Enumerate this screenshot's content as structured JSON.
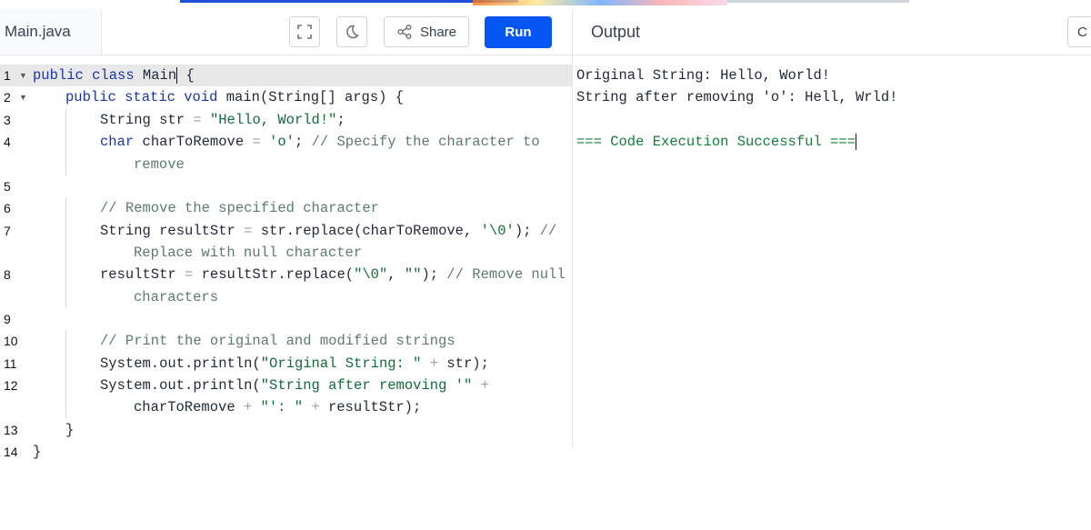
{
  "editor": {
    "file_name": "Main.java",
    "share_label": "Share",
    "run_label": "Run"
  },
  "output": {
    "title": "Output",
    "clear_label": "C",
    "lines": [
      "Original String: Hello, World!",
      "String after removing 'o': Hell, Wrld!",
      "",
      "=== Code Execution Successful ==="
    ]
  },
  "code_lines": [
    {
      "num": "1",
      "fold": true
    },
    {
      "num": "2",
      "fold": true
    },
    {
      "num": "3"
    },
    {
      "num": "4"
    },
    {
      "num": "5"
    },
    {
      "num": "6"
    },
    {
      "num": "7"
    },
    {
      "num": "8"
    },
    {
      "num": "9"
    },
    {
      "num": "10"
    },
    {
      "num": "11"
    },
    {
      "num": "12"
    },
    {
      "num": "13"
    },
    {
      "num": "14"
    }
  ],
  "code_text": {
    "l1_kw": "public class ",
    "l1_name": "Main",
    "l1_rest": " {",
    "l2_kw": "public static void ",
    "l2_rest": "main(String[] args) {",
    "l3_a": "String str ",
    "l3_eq": "= ",
    "l3_str": "\"Hello, World!\"",
    "l3_end": ";",
    "l4_kw": "char ",
    "l4_a": "charToRemove ",
    "l4_eq": "= ",
    "l4_str": "'o'",
    "l4_b": "; ",
    "l4_cm": "// Specify the character to",
    "l4_cm2": "remove",
    "l6_cm": "// Remove the specified character",
    "l7_a": "String resultStr ",
    "l7_eq": "= ",
    "l7_b": "str.replace(charToRemove, ",
    "l7_str": "'\\0'",
    "l7_c": "); ",
    "l7_cm": "//",
    "l7_cm2": "Replace with null character",
    "l8_a": "resultStr ",
    "l8_eq": "= ",
    "l8_b": "resultStr.replace(",
    "l8_str1": "\"\\0\"",
    "l8_c": ", ",
    "l8_str2": "\"\"",
    "l8_d": "); ",
    "l8_cm": "// Remove null",
    "l8_cm2": "characters",
    "l10_cm": "// Print the original and modified strings",
    "l11_a": "System.out.println(",
    "l11_str": "\"Original String: \"",
    "l11_op": " + ",
    "l11_b": "str);",
    "l12_a": "System.out.println(",
    "l12_str": "\"String after removing '\"",
    "l12_op": " +",
    "l12_c": "charToRemove ",
    "l12_op2": "+ ",
    "l12_str2": "\"': \"",
    "l12_op3": " + ",
    "l12_d": "resultStr);",
    "l13": "}",
    "l14": "}"
  }
}
